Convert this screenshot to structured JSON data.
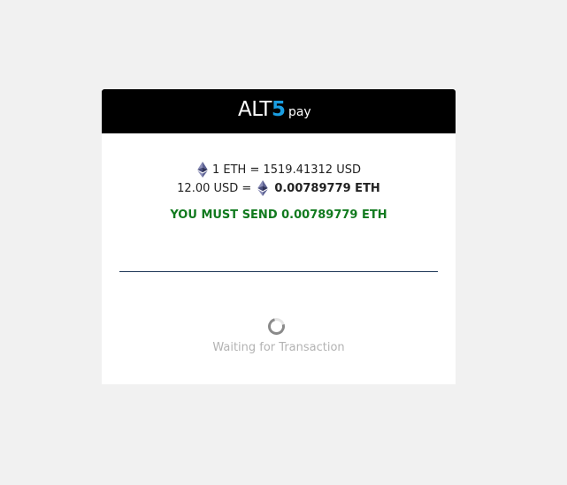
{
  "header": {
    "logo_alt": "ALT",
    "logo_five": "5",
    "logo_pay": "pay",
    "background_color": "#000000",
    "accent_color": "#1a9ee2"
  },
  "rates": {
    "line1_text": "1 ETH = 1519.41312 USD",
    "line2_prefix": "12.00 USD =",
    "line2_amount": "0.00789779 ETH",
    "eth_icon": "ethereum-icon"
  },
  "payment": {
    "must_send_text": "YOU MUST SEND 0.00789779 ETH",
    "must_send_color": "#117a1e"
  },
  "status": {
    "spinner_icon": "loading-spinner-icon",
    "waiting_text": "Waiting for Transaction"
  },
  "colors": {
    "page_background": "#f1f1f1",
    "card_background": "#ffffff",
    "divider": "#1c3556"
  }
}
